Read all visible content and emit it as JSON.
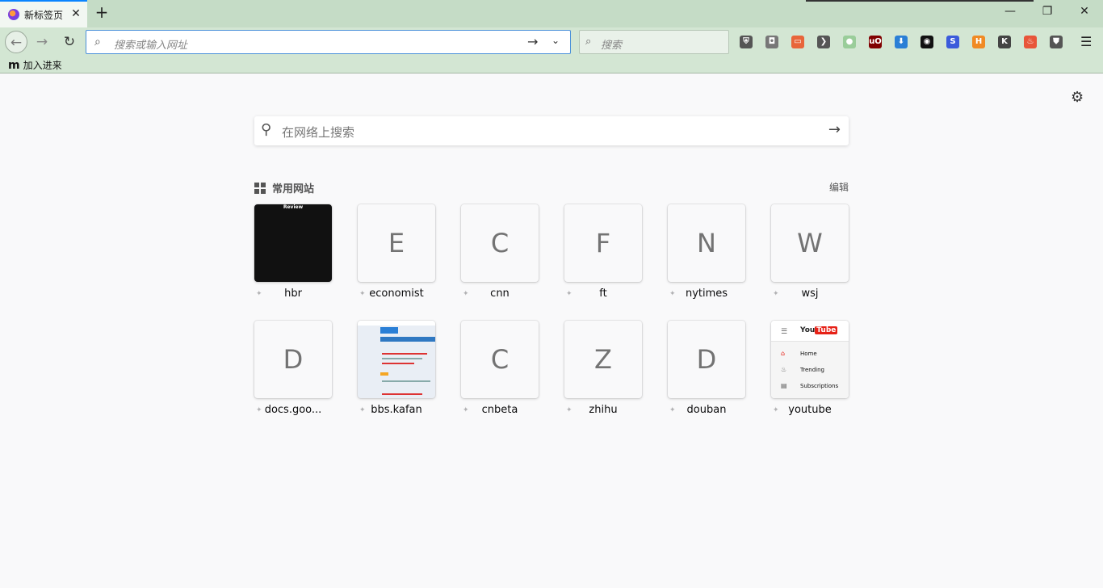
{
  "window": {
    "tab_title": "新标签页",
    "tab_close": "✕",
    "new_tab": "+",
    "minimize": "—",
    "restore": "❐",
    "close": "✕"
  },
  "toolbar": {
    "back_icon": "←",
    "forward_icon": "→",
    "reload_icon": "↻",
    "url_placeholder": "搜索或输入网址",
    "go_icon": "→",
    "dropdown_icon": "⌄",
    "search_placeholder": "搜索",
    "menu_icon": "☰",
    "extensions": [
      {
        "name": "bitwarden-icon",
        "glyph": "⛨",
        "color": "#555555"
      },
      {
        "name": "ghostery-icon",
        "glyph": "◘",
        "color": "#777777"
      },
      {
        "name": "reader-icon",
        "glyph": "▭",
        "color": "#e8653a"
      },
      {
        "name": "pocket-icon",
        "glyph": "❯",
        "color": "#555555"
      },
      {
        "name": "green-dot-icon",
        "glyph": "●",
        "color": "#9acd9a"
      },
      {
        "name": "ublock-icon",
        "glyph": "uO",
        "color": "#800000"
      },
      {
        "name": "download-icon",
        "glyph": "⬇",
        "color": "#2a7fd6"
      },
      {
        "name": "tampermonkey-icon",
        "glyph": "◉",
        "color": "#111111"
      },
      {
        "name": "stylus-icon",
        "glyph": "S",
        "color": "#3b5bdb"
      },
      {
        "name": "hackbar-icon",
        "glyph": "H",
        "color": "#f08a24"
      },
      {
        "name": "k-icon",
        "glyph": "K",
        "color": "#444444"
      },
      {
        "name": "flame-icon",
        "glyph": "♨",
        "color": "#e8553a"
      },
      {
        "name": "shield-icon",
        "glyph": "⛊",
        "color": "#555555"
      }
    ]
  },
  "bookmarks": {
    "items": [
      {
        "icon": "m",
        "label": "加入进来"
      }
    ]
  },
  "content": {
    "settings_icon": "⚙",
    "search_placeholder": "在网络上搜索",
    "search_icon": "🔍",
    "search_go": "→",
    "top_sites_title": "常用网站",
    "edit_label": "编辑",
    "pin_glyph": "✦",
    "sites": [
      {
        "label": "hbr",
        "letter": "",
        "kind": "hbr",
        "thumb_text": "Review"
      },
      {
        "label": "economist",
        "letter": "E",
        "kind": "letter"
      },
      {
        "label": "cnn",
        "letter": "C",
        "kind": "letter"
      },
      {
        "label": "ft",
        "letter": "F",
        "kind": "letter"
      },
      {
        "label": "nytimes",
        "letter": "N",
        "kind": "letter"
      },
      {
        "label": "wsj",
        "letter": "W",
        "kind": "letter"
      },
      {
        "label": "docs.goo...",
        "letter": "D",
        "kind": "letter"
      },
      {
        "label": "bbs.kafan",
        "letter": "",
        "kind": "kafan"
      },
      {
        "label": "cnbeta",
        "letter": "C",
        "kind": "letter"
      },
      {
        "label": "zhihu",
        "letter": "Z",
        "kind": "letter"
      },
      {
        "label": "douban",
        "letter": "D",
        "kind": "letter"
      },
      {
        "label": "youtube",
        "letter": "",
        "kind": "youtube",
        "yt_logo_prefix": "You",
        "yt_logo_suffix": "Tube",
        "yt_items": [
          "Home",
          "Trending",
          "Subscriptions"
        ]
      }
    ]
  }
}
